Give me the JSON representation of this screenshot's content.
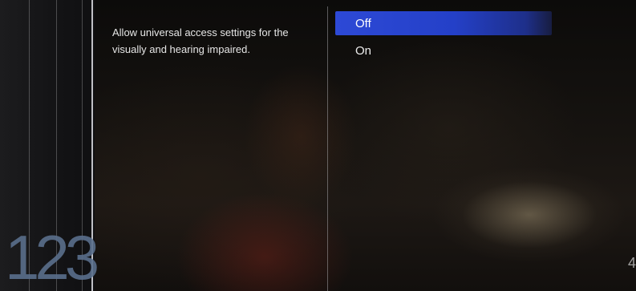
{
  "sidebar": {
    "page_number": "123"
  },
  "setting": {
    "description": "Allow universal access settings for the visually and hearing impaired."
  },
  "options": [
    {
      "label": "Off",
      "selected": true
    },
    {
      "label": "On",
      "selected": false
    }
  ],
  "edge_glyph": "4",
  "colors": {
    "highlight": "#2d49d6",
    "page_number": "#5a6f8c",
    "text": "#e6e6e6"
  }
}
